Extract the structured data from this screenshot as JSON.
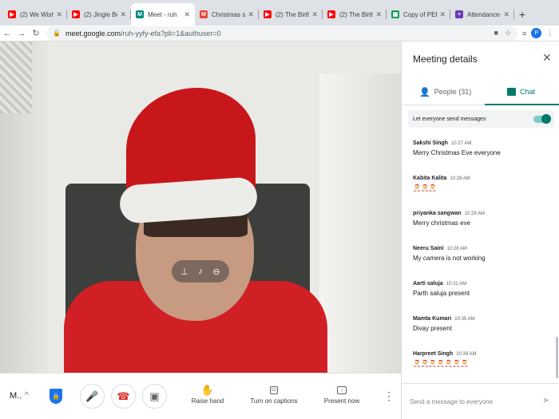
{
  "tabs": [
    {
      "title": "(2) We Wish Yo",
      "icon": "youtube-icon",
      "color": "#ff0000",
      "active": false
    },
    {
      "title": "(2) Jingle Bells",
      "icon": "youtube-icon",
      "color": "#ff0000",
      "active": false
    },
    {
      "title": "Meet - ruh",
      "icon": "meet-icon",
      "color": "#00897b",
      "active": true
    },
    {
      "title": "Christmas sto",
      "icon": "gmail-icon",
      "color": "#ea4335",
      "active": false
    },
    {
      "title": "(2) The Birth of",
      "icon": "youtube-icon",
      "color": "#ff0000",
      "active": false
    },
    {
      "title": "(2) The Birth of",
      "icon": "youtube-icon",
      "color": "#ff0000",
      "active": false
    },
    {
      "title": "Copy of PERIC",
      "icon": "sheets-icon",
      "color": "#0f9d58",
      "active": false
    },
    {
      "title": "Attendance-Cl",
      "icon": "forms-icon",
      "color": "#673ab7",
      "active": false
    }
  ],
  "browser": {
    "url_host": "meet.google.com",
    "url_rest": "/ruh-yyfy-efa?pli=1&authuser=0",
    "profile_initial": "P"
  },
  "bottombar": {
    "meeting_code": "M..",
    "raise_hand": "Raise hand",
    "captions": "Turn on captions",
    "present": "Present now"
  },
  "panel": {
    "title": "Meeting details",
    "people_tab": "People (31)",
    "chat_tab": "Chat",
    "toggle_label": "Let everyone send messages",
    "toggle_on": true,
    "input_placeholder": "Send a message to everyone",
    "messages": [
      {
        "name": "Sakshi Singh",
        "time": "10:27 AM",
        "text": "Merry Christmas Eve everyone"
      },
      {
        "name": "Kabita Kalita",
        "time": "10:28 AM",
        "text": "🎅🎅🎅"
      },
      {
        "name": "priyanka sangwan",
        "time": "10:28 AM",
        "text": "Merry christmas eve"
      },
      {
        "name": "Neeru Saini",
        "time": "10:28 AM",
        "text": "My camera is not working"
      },
      {
        "name": "Aarti saluja",
        "time": "10:31 AM",
        "text": "Parth saluja present"
      },
      {
        "name": "Mamta Kumari",
        "time": "10:35 AM",
        "text": "Divay present"
      },
      {
        "name": "Harpreet Singh",
        "time": "10:39 AM",
        "text": "🎅🎅🎅🎅🎅🎅🎅"
      }
    ]
  },
  "colors": {
    "accent": "#00796b",
    "hangup": "#d93025",
    "security": "#1a73e8"
  }
}
